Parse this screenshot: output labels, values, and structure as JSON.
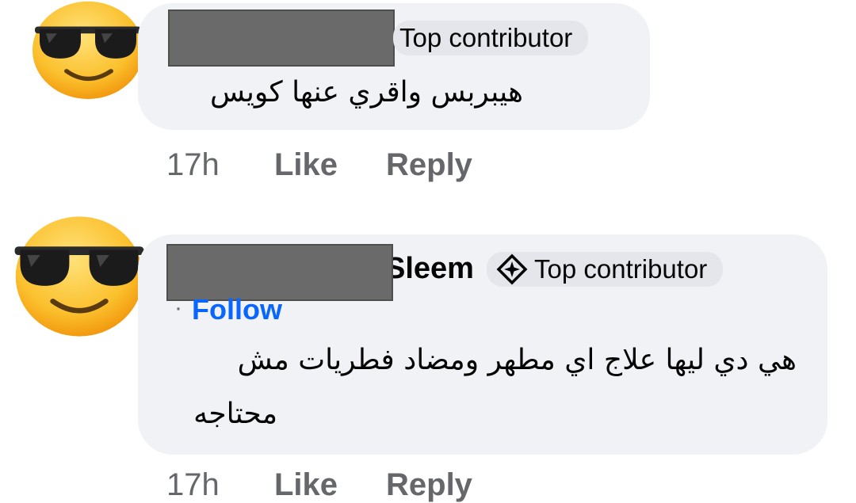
{
  "comments": [
    {
      "name_visible": "",
      "badge_label": "Top contributor",
      "badge_icon": "top-contributor-icon",
      "text": "هيبربس واقري عنها كويس",
      "time": "17h",
      "like_label": "Like",
      "reply_label": "Reply",
      "avatar_icon": "sunglasses-emoji"
    },
    {
      "name_visible": "Sleem",
      "badge_label": "Top contributor",
      "badge_icon": "top-contributor-icon",
      "follow_label": "Follow",
      "follow_dot": "·",
      "text_line1": "هي دي ليها علاج اي مطهر ومضاد فطريات مش",
      "text_line2": "محتاجه",
      "time": "17h",
      "like_label": "Like",
      "reply_label": "Reply",
      "avatar_icon": "sunglasses-emoji"
    }
  ],
  "colors": {
    "bubble": "#f0f2f5",
    "badge": "#e4e6eb",
    "meta": "#65676b",
    "follow": "#0866ff",
    "redaction": "#6a6a6a"
  }
}
